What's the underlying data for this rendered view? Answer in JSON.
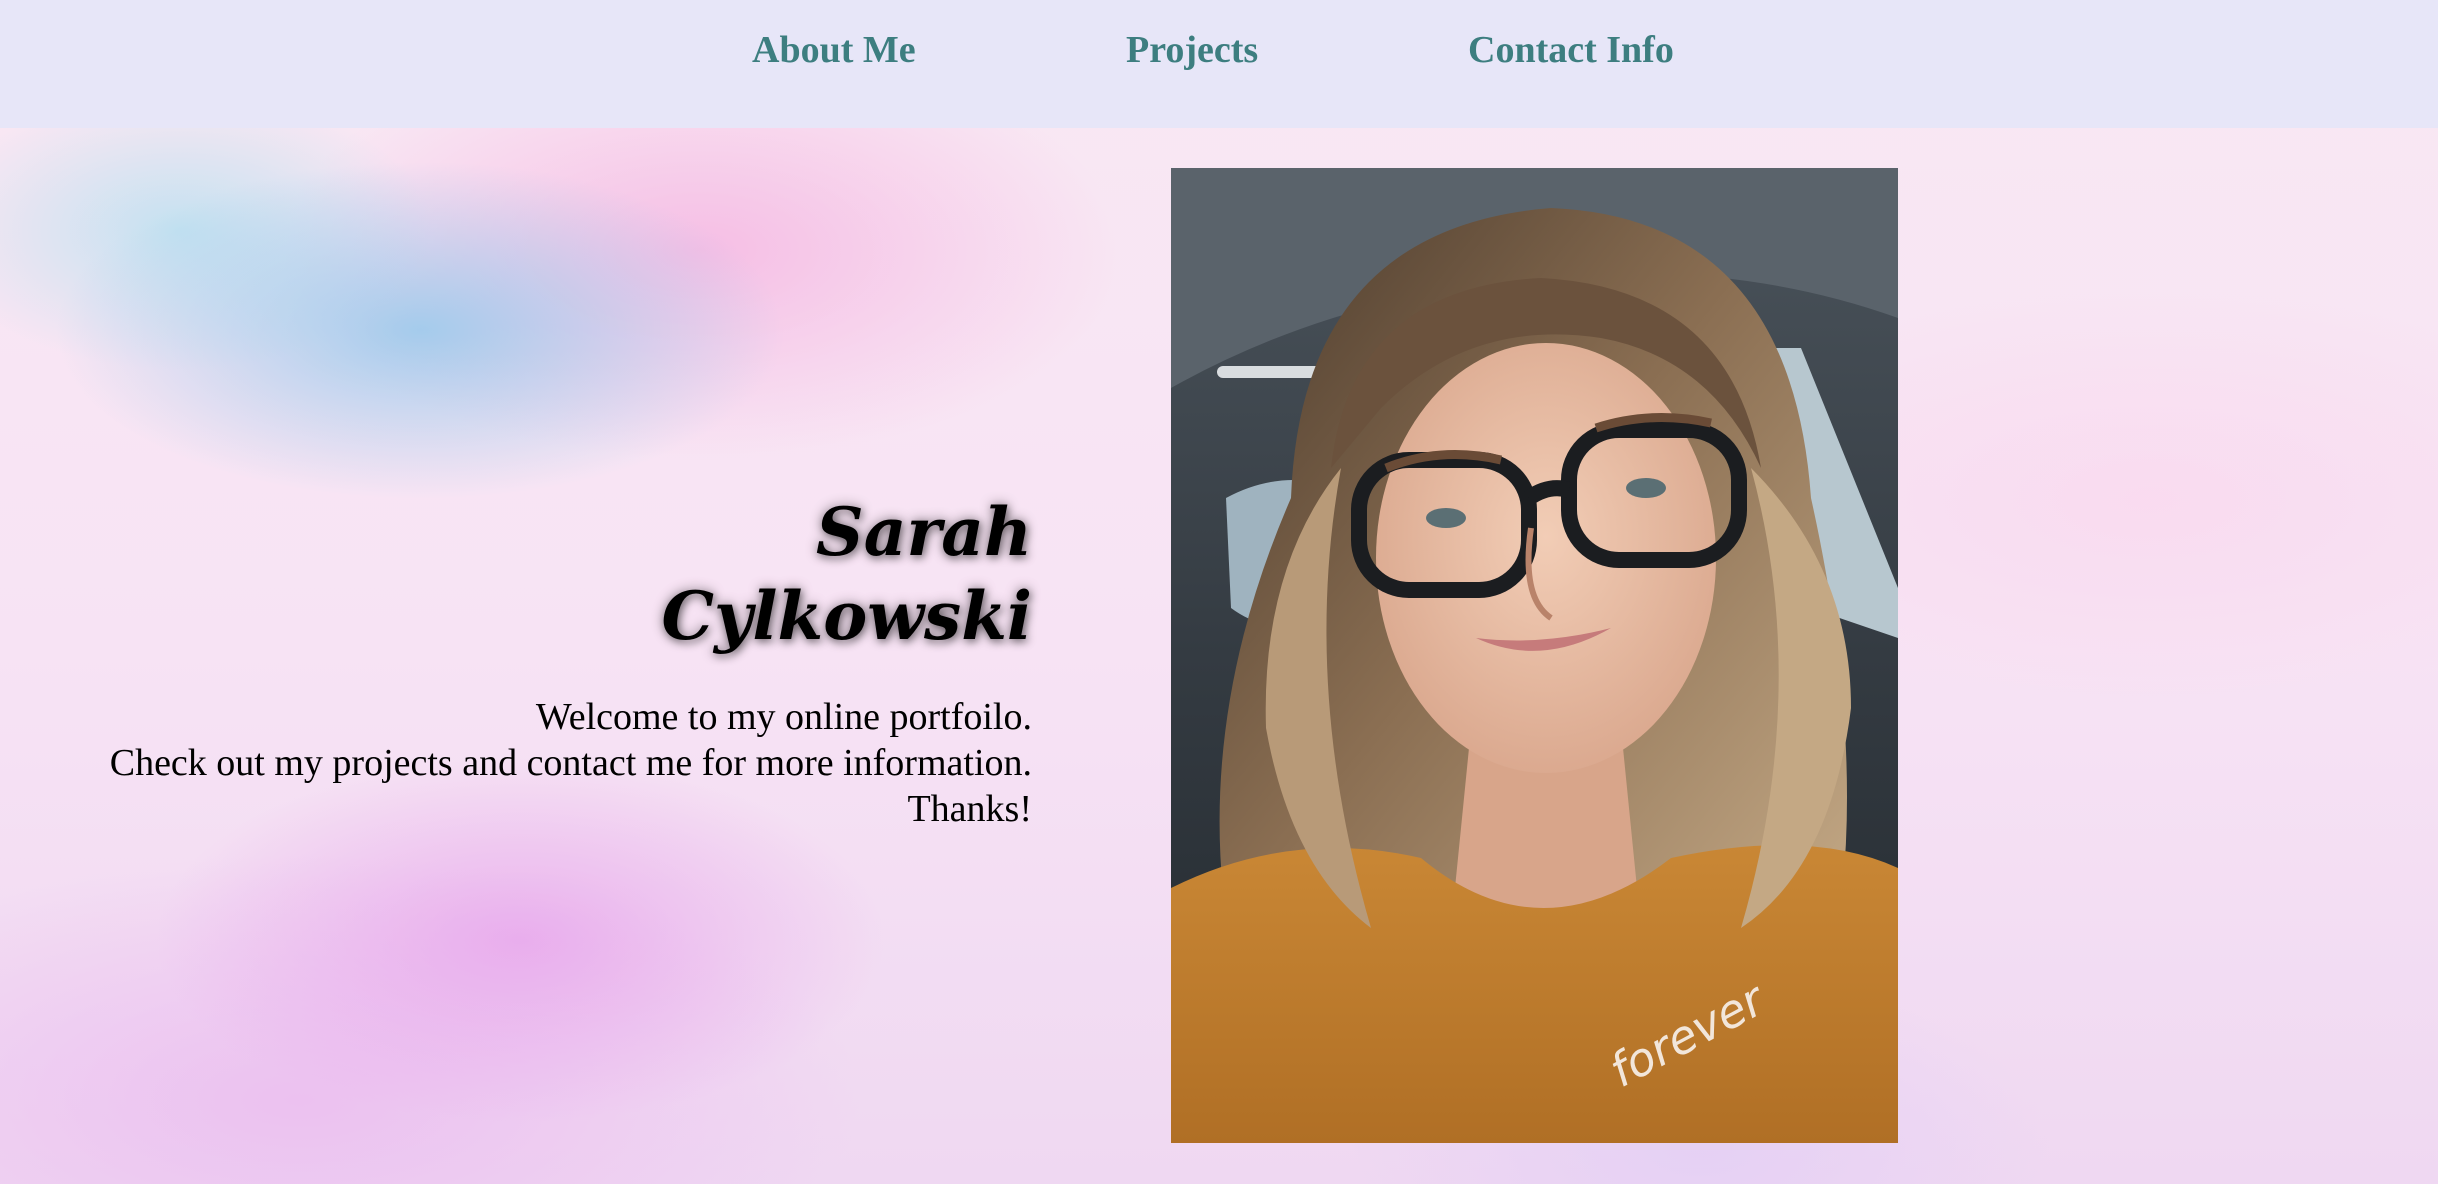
{
  "nav": {
    "items": [
      {
        "label": "About Me"
      },
      {
        "label": "Projects"
      },
      {
        "label": "Contact Info"
      }
    ]
  },
  "hero": {
    "name_first": "Sarah",
    "name_last": "Cylkowski",
    "welcome_lines": [
      "Welcome to my online portfoilo.",
      "Check out my projects and contact me for more information.",
      "Thanks!"
    ],
    "photo_shirt_text": "forever"
  },
  "colors": {
    "nav_background": "#e7e6f8",
    "nav_link": "#3d7e80",
    "text": "#000000"
  }
}
